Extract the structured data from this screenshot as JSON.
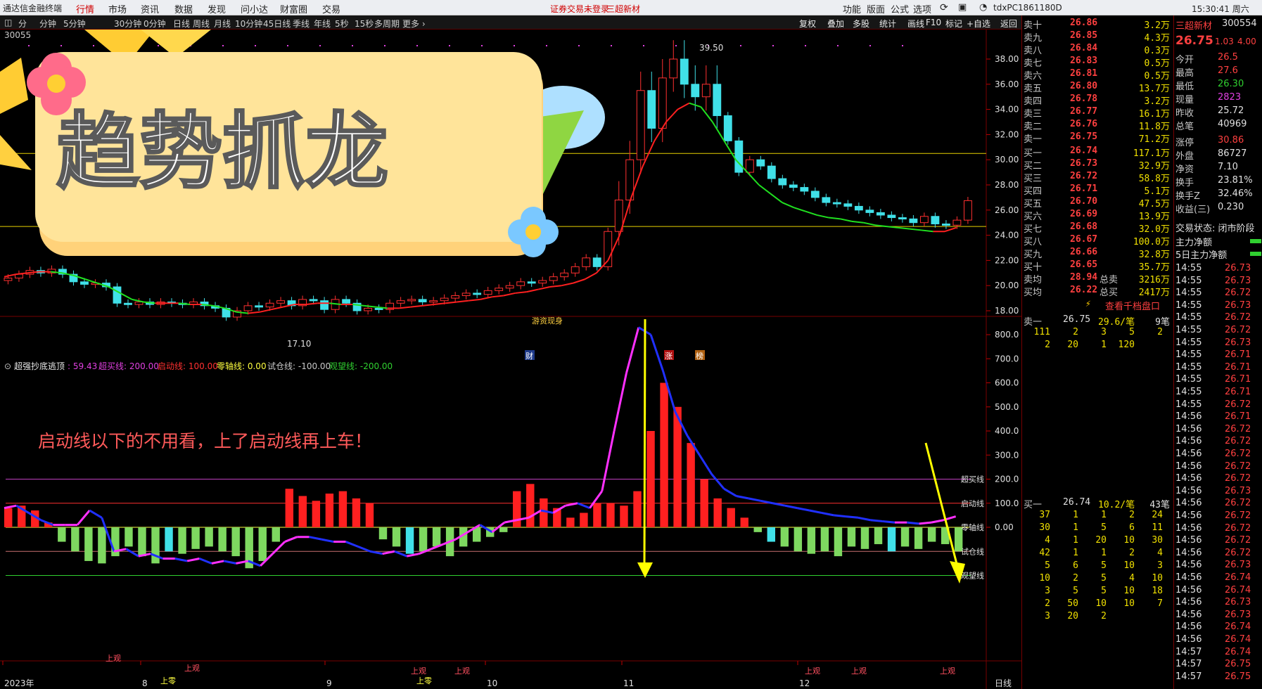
{
  "menubar": {
    "left_label": "通达信金融终端",
    "items": [
      "行情",
      "市场",
      "资讯",
      "数据",
      "发现",
      "问小达",
      "财富圈",
      "交易"
    ],
    "notice_1": "证券交易未登录",
    "notice_2": "三超新材",
    "right_items": [
      "功能",
      "版面",
      "公式",
      "选项"
    ],
    "machine": "tdxPC1861180D",
    "time": "15:30:41 周六"
  },
  "period_tabs": [
    "分",
    "分钟",
    "5分钟",
    "30分钟",
    "0分钟",
    "日线",
    "周线",
    "月线",
    "10分钟",
    "45日线",
    "季线",
    "年线",
    "5秒",
    "15秒",
    "多周期",
    "更多 ›"
  ],
  "tools": [
    "复权",
    "叠加",
    "多股",
    "统计",
    "画线",
    "F10",
    "标记",
    "+自选",
    "返回"
  ],
  "code_fragment": "30055",
  "banner": {
    "title": "趋势抓龙"
  },
  "annotation": "启动线以下的不用看，上了启动线再上车！",
  "price_axis": {
    "ticks": [
      38,
      36,
      34,
      32,
      30,
      28,
      26,
      24,
      22,
      20,
      18
    ],
    "labels": [
      "38.00",
      "36.00",
      "34.00",
      "32.00",
      "30.00",
      "28.00",
      "26.00",
      "24.00",
      "22.00",
      "20.00",
      "18.00"
    ],
    "high_label": "39.50",
    "low_label": "17.10",
    "hlines": [
      30.5,
      24.7
    ]
  },
  "event_tags": [
    "财",
    "涨",
    "榜"
  ],
  "youzi_label": "游资现身",
  "indicator": {
    "name": "超强抄底逃顶",
    "value": ": 59.43",
    "params": [
      {
        "label": "超买线: 200.00",
        "color": "#e040e0"
      },
      {
        "label": "启动线: 100.00",
        "color": "#ff3030"
      },
      {
        "label": "零轴线: 0.00",
        "color": "#ffff40"
      },
      {
        "label": "试仓线: -100.00",
        "color": "#c8c8c8"
      },
      {
        "label": "观望线: -200.00",
        "color": "#30d030"
      }
    ],
    "axis": {
      "ticks": [
        800,
        700,
        600,
        500,
        400,
        300,
        200,
        100,
        0
      ],
      "labels": [
        "800.0",
        "700.0",
        "600.0",
        "500.0",
        "400.0",
        "300.0",
        "200.0",
        "100.0",
        "0.00"
      ]
    },
    "line_labels": [
      "超买线",
      "启动线",
      "零轴线",
      "试仓线",
      "观望线"
    ],
    "signal_labels": [
      "上观",
      "上零",
      "上观",
      "上观",
      "上零",
      "上观",
      "上观",
      "上观",
      "上观"
    ]
  },
  "time_axis": {
    "labels": [
      "2023年",
      "8",
      "9",
      "10",
      "11",
      "12"
    ],
    "period": "日线"
  },
  "chart_data": {
    "type": "line",
    "title": "三超新材 300554",
    "price_close": [
      20.6,
      20.9,
      21.2,
      21.0,
      21.3,
      20.9,
      20.3,
      20.1,
      20.2,
      19.9,
      18.6,
      18.5,
      18.7,
      18.5,
      18.7,
      18.6,
      18.5,
      18.7,
      18.4,
      18.2,
      17.5,
      18.0,
      18.4,
      18.3,
      18.6,
      18.8,
      18.4,
      18.9,
      18.8,
      18.1,
      18.9,
      18.6,
      18.0,
      18.2,
      18.1,
      18.6,
      18.8,
      18.9,
      18.7,
      18.8,
      19.0,
      19.2,
      19.4,
      19.3,
      19.6,
      19.8,
      20.0,
      20.3,
      20.2,
      20.4,
      20.7,
      21.0,
      21.5,
      22.2,
      21.5,
      24.3,
      26.8,
      30.0,
      35.5,
      32.5,
      36.5,
      38.0,
      36.0,
      35.0,
      36.0,
      33.5,
      31.5,
      29.0,
      30.0,
      29.5,
      28.5,
      28.0,
      27.8,
      27.5,
      27.0,
      26.6,
      26.5,
      26.3,
      26.0,
      25.8,
      25.6,
      25.4,
      25.3,
      25.0,
      25.5,
      24.9,
      24.8,
      25.2,
      26.75
    ],
    "ma_line": [
      20.7,
      20.9,
      21.0,
      21.1,
      21.1,
      21.0,
      20.8,
      20.5,
      20.2,
      19.9,
      19.4,
      18.9,
      18.7,
      18.6,
      18.6,
      18.6,
      18.5,
      18.5,
      18.4,
      18.2,
      17.9,
      17.8,
      17.9,
      18.1,
      18.3,
      18.5,
      18.5,
      18.6,
      18.6,
      18.5,
      18.5,
      18.4,
      18.3,
      18.2,
      18.2,
      18.3,
      18.4,
      18.5,
      18.6,
      18.7,
      18.8,
      18.9,
      19.1,
      19.2,
      19.4,
      19.5,
      19.7,
      19.9,
      20.0,
      20.2,
      20.5,
      21.0,
      22.0,
      24.0,
      27.0,
      29.5,
      31.5,
      33.0,
      34.0,
      34.5,
      34.2,
      33.0,
      31.5,
      30.0,
      29.0,
      28.0,
      27.3,
      26.6,
      26.2,
      25.9,
      25.6,
      25.4,
      25.3,
      25.1,
      25.0,
      24.8,
      24.7,
      24.6,
      24.5,
      24.4,
      24.3,
      24.3,
      24.6
    ],
    "indicator_line": [
      80,
      90,
      60,
      30,
      10,
      10,
      10,
      70,
      40,
      -100,
      -90,
      -120,
      -110,
      -130,
      -130,
      -140,
      -130,
      -150,
      -140,
      -150,
      -140,
      -160,
      -110,
      -60,
      -40,
      -40,
      -50,
      -60,
      -60,
      -80,
      -100,
      -110,
      -100,
      -120,
      -110,
      -90,
      -70,
      -50,
      -20,
      10,
      -20,
      20,
      30,
      40,
      70,
      60,
      90,
      100,
      80,
      150,
      400,
      640,
      830,
      800,
      650,
      480,
      380,
      300,
      220,
      160,
      130,
      120,
      110,
      100,
      90,
      80,
      70,
      60,
      50,
      45,
      40,
      30,
      25,
      20,
      20,
      15,
      20,
      30,
      45
    ],
    "hist_values": [
      80,
      90,
      70,
      20,
      -60,
      -100,
      -140,
      -150,
      -120,
      -80,
      -120,
      -150,
      -100,
      -110,
      -90,
      -80,
      -100,
      -120,
      -170,
      -140,
      -60,
      160,
      130,
      110,
      140,
      150,
      120,
      100,
      -50,
      -80,
      -110,
      -100,
      -80,
      -120,
      -80,
      -60,
      -40,
      -20,
      150,
      180,
      120,
      80,
      40,
      60,
      100,
      100,
      90,
      150,
      400,
      600,
      500,
      350,
      200,
      120,
      80,
      40,
      -20,
      -60,
      -80,
      -100,
      -110,
      -100,
      -120,
      -80,
      -90,
      -70,
      -100,
      -80,
      -90,
      -60,
      -70,
      -100
    ],
    "ylabel": "",
    "xlabel": ""
  },
  "ask_book": {
    "rows": [
      {
        "label": "卖十",
        "price": "26.86",
        "vol": "3.2万"
      },
      {
        "label": "卖九",
        "price": "26.85",
        "vol": "4.3万"
      },
      {
        "label": "卖八",
        "price": "26.84",
        "vol": "0.3万"
      },
      {
        "label": "卖七",
        "price": "26.83",
        "vol": "0.5万"
      },
      {
        "label": "卖六",
        "price": "26.81",
        "vol": "0.5万"
      },
      {
        "label": "卖五",
        "price": "26.80",
        "vol": "13.7万"
      },
      {
        "label": "卖四",
        "price": "26.78",
        "vol": "3.2万"
      },
      {
        "label": "卖三",
        "price": "26.77",
        "vol": "16.1万"
      },
      {
        "label": "卖二",
        "price": "26.76",
        "vol": "11.8万"
      },
      {
        "label": "卖一",
        "price": "26.75",
        "vol": "71.2万"
      }
    ]
  },
  "bid_book": {
    "rows": [
      {
        "label": "买一",
        "price": "26.74",
        "vol": "117.1万"
      },
      {
        "label": "买二",
        "price": "26.73",
        "vol": "32.9万"
      },
      {
        "label": "买三",
        "price": "26.72",
        "vol": "58.8万"
      },
      {
        "label": "买四",
        "price": "26.71",
        "vol": "5.1万"
      },
      {
        "label": "买五",
        "price": "26.70",
        "vol": "47.5万"
      },
      {
        "label": "买六",
        "price": "26.69",
        "vol": "13.9万"
      },
      {
        "label": "买七",
        "price": "26.68",
        "vol": "32.0万"
      },
      {
        "label": "买八",
        "price": "26.67",
        "vol": "100.0万"
      },
      {
        "label": "买九",
        "price": "26.66",
        "vol": "32.8万"
      },
      {
        "label": "买十",
        "price": "26.65",
        "vol": "35.7万"
      }
    ]
  },
  "summary": {
    "row1": {
      "l1": "卖均",
      "v1": "28.94",
      "l2": "总卖",
      "v2": "3216万"
    },
    "row2": {
      "l1": "买均",
      "v1": "26.22",
      "l2": "总买",
      "v2": "2417万"
    },
    "link": "查看千档盘口"
  },
  "level_ask": {
    "label": "卖一",
    "price": "26.75",
    "per": "29.6/笔",
    "count": "9笔",
    "grid": [
      [
        "111",
        "2",
        "3",
        "5",
        "2"
      ],
      [
        "2",
        "20",
        "1",
        "120",
        ""
      ]
    ]
  },
  "level_bid": {
    "label": "买一",
    "price": "26.74",
    "per": "10.2/笔",
    "count": "43笔",
    "grid": [
      [
        "37",
        "1",
        "1",
        "2",
        "24"
      ],
      [
        "30",
        "1",
        "5",
        "6",
        "11"
      ],
      [
        "4",
        "1",
        "20",
        "10",
        "30"
      ],
      [
        "42",
        "1",
        "1",
        "2",
        "4"
      ],
      [
        "5",
        "6",
        "5",
        "10",
        "3"
      ],
      [
        "10",
        "2",
        "5",
        "4",
        "10"
      ],
      [
        "3",
        "5",
        "5",
        "10",
        "18"
      ],
      [
        "2",
        "50",
        "10",
        "10",
        "7"
      ],
      [
        "3",
        "20",
        "2",
        "",
        ""
      ]
    ]
  },
  "stock": {
    "name": "三超新材",
    "code": "300554",
    "price": "26.75",
    "change": "1.03",
    "pct": "4.00"
  },
  "quote": [
    {
      "label": "今开",
      "value": "26.5"
    },
    {
      "label": "最高",
      "value": "27.6"
    },
    {
      "label": "最低",
      "value": "26.30"
    },
    {
      "label": "现量",
      "value": "2823"
    },
    {
      "label": "昨收",
      "value": "25.72"
    },
    {
      "label": "总笔",
      "value": "40969"
    },
    {
      "label": "涨停",
      "value": "30.86"
    },
    {
      "label": "外盘",
      "value": "86727"
    },
    {
      "label": "净资",
      "value": "7.10"
    },
    {
      "label": "换手",
      "value": "23.81%"
    },
    {
      "label": "换手Z",
      "value": "32.46%"
    },
    {
      "label": "收益(三)",
      "value": "0.230"
    }
  ],
  "trade_status": "交易状态: 闭市阶段",
  "flow": [
    {
      "label": "主力净额"
    },
    {
      "label": "5日主力净额"
    }
  ],
  "ticks": [
    {
      "t": "14:55",
      "p": "26.73"
    },
    {
      "t": "14:55",
      "p": "26.73"
    },
    {
      "t": "14:55",
      "p": "26.72"
    },
    {
      "t": "14:55",
      "p": "26.73"
    },
    {
      "t": "14:55",
      "p": "26.72"
    },
    {
      "t": "14:55",
      "p": "26.72"
    },
    {
      "t": "14:55",
      "p": "26.73"
    },
    {
      "t": "14:55",
      "p": "26.71"
    },
    {
      "t": "14:55",
      "p": "26.71"
    },
    {
      "t": "14:55",
      "p": "26.71"
    },
    {
      "t": "14:55",
      "p": "26.71"
    },
    {
      "t": "14:55",
      "p": "26.72"
    },
    {
      "t": "14:56",
      "p": "26.71"
    },
    {
      "t": "14:56",
      "p": "26.72"
    },
    {
      "t": "14:56",
      "p": "26.72"
    },
    {
      "t": "14:56",
      "p": "26.72"
    },
    {
      "t": "14:56",
      "p": "26.72"
    },
    {
      "t": "14:56",
      "p": "26.72"
    },
    {
      "t": "14:56",
      "p": "26.73"
    },
    {
      "t": "14:56",
      "p": "26.72"
    },
    {
      "t": "14:56",
      "p": "26.72"
    },
    {
      "t": "14:56",
      "p": "26.72"
    },
    {
      "t": "14:56",
      "p": "26.72"
    },
    {
      "t": "14:56",
      "p": "26.72"
    },
    {
      "t": "14:56",
      "p": "26.73"
    },
    {
      "t": "14:56",
      "p": "26.74"
    },
    {
      "t": "14:56",
      "p": "26.74"
    },
    {
      "t": "14:56",
      "p": "26.73"
    },
    {
      "t": "14:56",
      "p": "26.73"
    },
    {
      "t": "14:56",
      "p": "26.74"
    },
    {
      "t": "14:56",
      "p": "26.74"
    },
    {
      "t": "14:57",
      "p": "26.74"
    },
    {
      "t": "14:57",
      "p": "26.75"
    },
    {
      "t": "14:57",
      "p": "26.75"
    }
  ]
}
